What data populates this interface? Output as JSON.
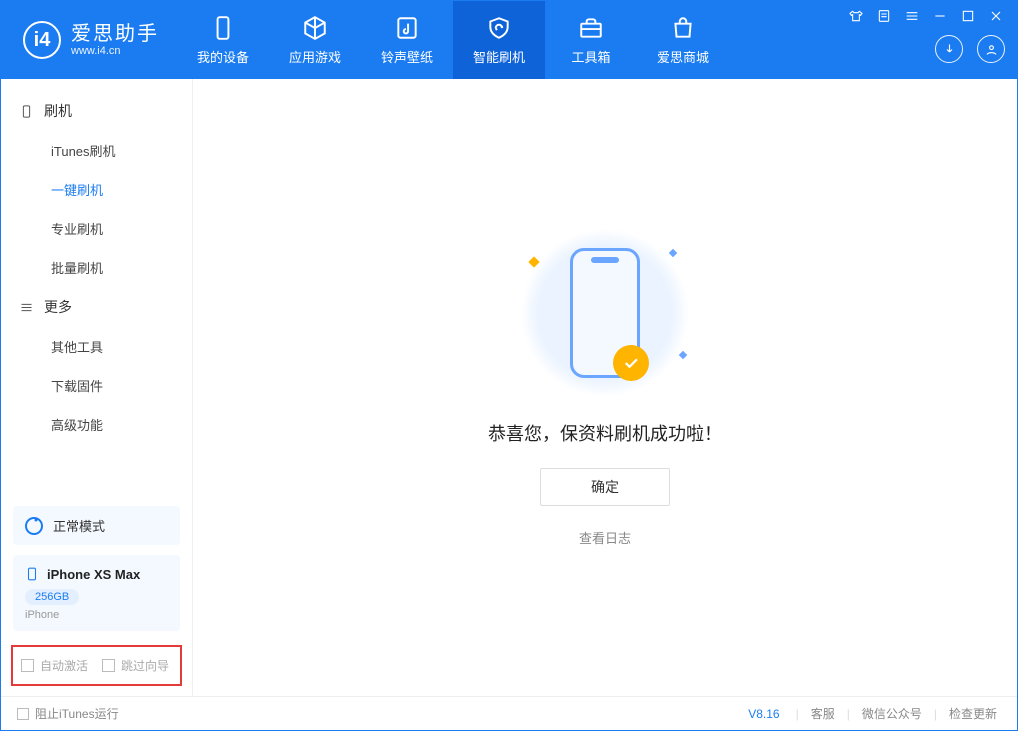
{
  "app": {
    "name_cn": "爱思助手",
    "name_en": "www.i4.cn"
  },
  "tabs": [
    {
      "label": "我的设备"
    },
    {
      "label": "应用游戏"
    },
    {
      "label": "铃声壁纸"
    },
    {
      "label": "智能刷机"
    },
    {
      "label": "工具箱"
    },
    {
      "label": "爱思商城"
    }
  ],
  "sidebar": {
    "group1": {
      "title": "刷机",
      "items": [
        "iTunes刷机",
        "一键刷机",
        "专业刷机",
        "批量刷机"
      ]
    },
    "group2": {
      "title": "更多",
      "items": [
        "其他工具",
        "下载固件",
        "高级功能"
      ]
    }
  },
  "mode": {
    "label": "正常模式"
  },
  "device": {
    "name": "iPhone XS Max",
    "capacity": "256GB",
    "type": "iPhone"
  },
  "options": {
    "opt1": "自动激活",
    "opt2": "跳过向导"
  },
  "result": {
    "message": "恭喜您，保资料刷机成功啦！",
    "ok": "确定",
    "log": "查看日志"
  },
  "footer": {
    "block_itunes": "阻止iTunes运行",
    "version": "V8.16",
    "links": [
      "客服",
      "微信公众号",
      "检查更新"
    ]
  }
}
